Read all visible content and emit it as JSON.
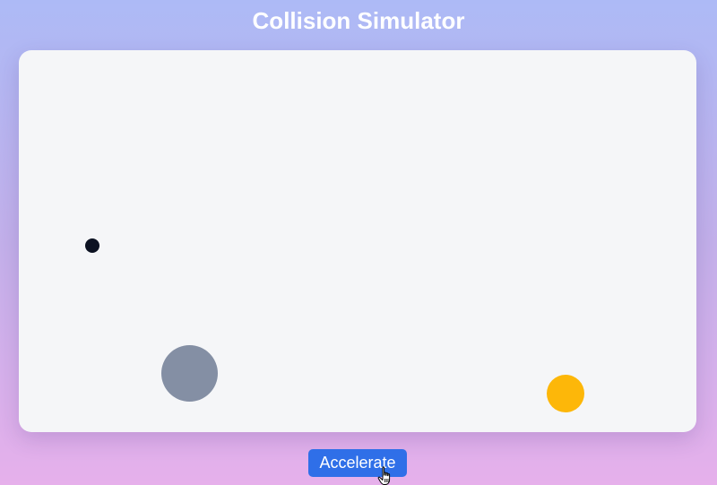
{
  "page": {
    "title": "Collision Simulator"
  },
  "simulation": {
    "balls": [
      {
        "name": "small-ball",
        "color": "#0c1222"
      },
      {
        "name": "large-ball",
        "color": "#848fa4"
      },
      {
        "name": "medium-ball",
        "color": "#fdb709"
      }
    ]
  },
  "controls": {
    "accelerate_label": "Accelerate",
    "accelerate_color": "#2f6fe8"
  },
  "cursor": {
    "icon": "hand-pointer-icon"
  }
}
